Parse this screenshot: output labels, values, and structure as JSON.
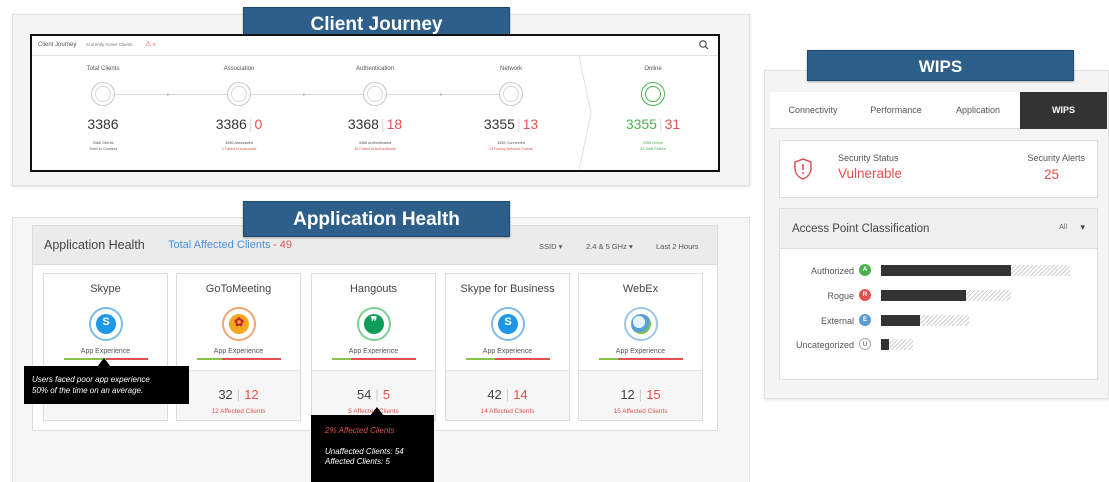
{
  "banners": {
    "client_journey": "Client Journey",
    "application_health": "Application Health",
    "wips": "WIPS"
  },
  "client_journey": {
    "header_title": "Client Journey",
    "header_subtitle": "Currently Active Clients",
    "warning_count": "0",
    "stages": [
      {
        "label": "Total Clients",
        "value": "3386",
        "failed": "",
        "sub1": "3386 Clients",
        "sub2": "Tried to Connect",
        "icon": "monitor-icon"
      },
      {
        "label": "Association",
        "value": "3386",
        "failed": "0",
        "sub1": "3386 Associated",
        "sub2": "0 Failed to Associate",
        "icon": "association-icon"
      },
      {
        "label": "Authentication",
        "value": "3368",
        "failed": "18",
        "sub1": "3368 Authenticated",
        "sub2": "18 Failed to Authenticate",
        "icon": "lock-icon"
      },
      {
        "label": "Network",
        "value": "3355",
        "failed": "13",
        "sub1": "3355 Connected",
        "sub2": "13 Facing Network Failure",
        "icon": "gear-icon"
      },
      {
        "label": "Online",
        "value": "3355",
        "failed": "31",
        "sub1": "3355 Online",
        "sub2": "31 Total Failure",
        "icon": "globe-monitor-icon"
      }
    ]
  },
  "application_health": {
    "title": "Application Health",
    "affected_label": "Total Affected Clients",
    "affected_count": "- 49",
    "filters": {
      "ssid": "SSID",
      "band": "2.4 & 5 GHz",
      "range": "Last 2 Hours"
    },
    "apps": [
      {
        "name": "Skype",
        "label": "App Experience",
        "value": "",
        "failed": "",
        "affected": "",
        "icon": "skype-icon",
        "green_fraction": 0.5
      },
      {
        "name": "GoToMeeting",
        "label": "App Experience",
        "value": "32",
        "failed": "12",
        "affected": "12 Affected Clients",
        "icon": "gotomeeting-icon",
        "green_fraction": 0.3
      },
      {
        "name": "Hangouts",
        "label": "App Experience",
        "value": "54",
        "failed": "5",
        "affected": "5 Affected Clients",
        "icon": "hangouts-icon",
        "green_fraction": 0.22
      },
      {
        "name": "Skype for Business",
        "label": "App Experience",
        "value": "42",
        "failed": "14",
        "affected": "14 Affected Clients",
        "icon": "skype-business-icon",
        "green_fraction": 0.35
      },
      {
        "name": "WebEx",
        "label": "App Experience",
        "value": "12",
        "failed": "15",
        "affected": "15 Affected Clients",
        "icon": "webex-icon",
        "green_fraction": 0.22
      }
    ],
    "tooltip_skype": {
      "line1": "Users faced poor app experience",
      "line2": "50% of the time on an average."
    },
    "tooltip_hangouts": {
      "line1": "2% Affected Clients",
      "line2": "Unaffected Clients: 54",
      "line3": "Affected Clients: 5"
    }
  },
  "wips": {
    "tabs": [
      "Connectivity",
      "Performance",
      "Application",
      "WIPS"
    ],
    "active_tab": "WIPS",
    "security_status_label": "Security Status",
    "security_status_value": "Vulnerable",
    "security_alerts_label": "Security Alerts",
    "security_alerts_value": "25",
    "ap_classification_title": "Access Point Classification",
    "ap_filter": "All",
    "ap_rows": [
      {
        "label": "Authorized",
        "badge": "A",
        "badge_color": "#4caf50",
        "solid": 0.59,
        "hatch": 0.27
      },
      {
        "label": "Rogue",
        "badge": "R",
        "badge_color": "#e0524f",
        "solid": 0.39,
        "hatch": 0.21
      },
      {
        "label": "External",
        "badge": "E",
        "badge_color": "#5b9bd5",
        "solid": 0.18,
        "hatch": 0.22
      },
      {
        "label": "Uncategorized",
        "badge": "U",
        "badge_color": "#ffffff",
        "solid": 0.04,
        "hatch": 0.07
      }
    ]
  }
}
